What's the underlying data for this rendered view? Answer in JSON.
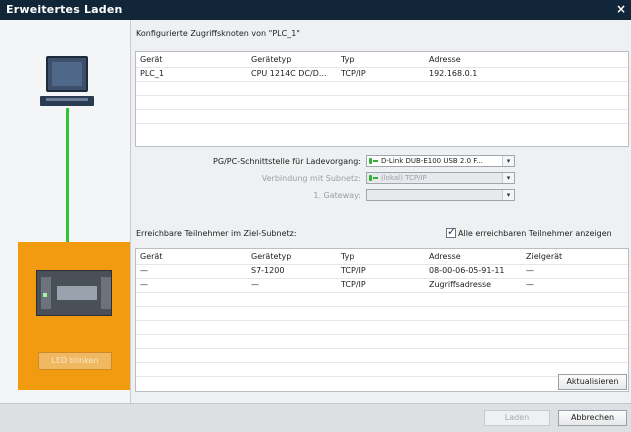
{
  "window": {
    "title": "Erweitertes Laden",
    "close": "×"
  },
  "configured": {
    "heading": "Konfigurierte Zugriffsknoten von \"PLC_1\"",
    "columns": [
      "Gerät",
      "Gerätetyp",
      "Typ",
      "Adresse"
    ],
    "rows": [
      [
        "PLC_1",
        "CPU 1214C DC/D...",
        "TCP/IP",
        "192.168.0.1"
      ]
    ]
  },
  "iface": {
    "pg_label": "PG/PC-Schnittstelle für Ladevorgang:",
    "pg_value": "D-Link DUB-E100 USB 2.0 F...",
    "subnet_label": "Verbindung mit Subnetz:",
    "subnet_value": "(lokal) TCP/IP",
    "gateway_label": "1. Gateway:",
    "gateway_value": ""
  },
  "reachable": {
    "heading": "Erreichbare Teilnehmer im Ziel-Subnetz:",
    "show_all_label": "Alle erreichbaren Teilnehmer anzeigen",
    "show_all_checked": true,
    "columns": [
      "Gerät",
      "Gerätetyp",
      "Typ",
      "Adresse",
      "Zielgerät"
    ],
    "rows": [
      [
        "—",
        "S7-1200",
        "TCP/IP",
        "08-00-06-05-91-11",
        "—"
      ],
      [
        "—",
        "—",
        "TCP/IP",
        "Zugriffsadresse",
        "—"
      ]
    ]
  },
  "left": {
    "led_button": "LED blinken"
  },
  "buttons": {
    "refresh": "Aktualisieren",
    "load": "Laden",
    "cancel": "Abbrechen"
  },
  "colors": {
    "title_bar": "#12263a",
    "plc_highlight": "#f29b11",
    "connection_line": "#33c433"
  }
}
